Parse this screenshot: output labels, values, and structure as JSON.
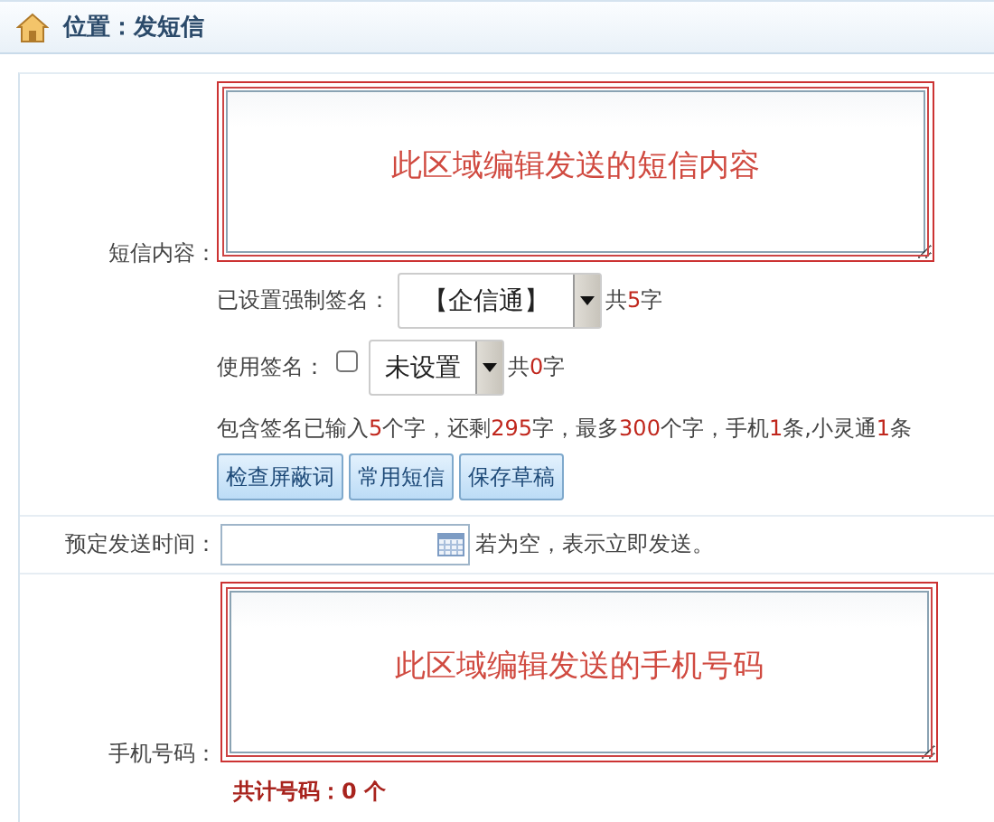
{
  "breadcrumb": {
    "label": "位置：发短信"
  },
  "message": {
    "label": "短信内容：",
    "placeholder": "此区域编辑发送的短信内容"
  },
  "forced_signature": {
    "label": "已设置强制签名：",
    "value": "【企信通】",
    "count": [
      {
        "text": "共",
        "highlight": false
      },
      {
        "text": "5",
        "highlight": true
      },
      {
        "text": "字",
        "highlight": false
      }
    ]
  },
  "use_signature": {
    "label": "使用签名：",
    "checked": false,
    "value": "未设置",
    "count": [
      {
        "text": "共",
        "highlight": false
      },
      {
        "text": "0",
        "highlight": true
      },
      {
        "text": "字",
        "highlight": false
      }
    ]
  },
  "summary": [
    {
      "text": "包含签名已输入",
      "highlight": false
    },
    {
      "text": "5",
      "highlight": true
    },
    {
      "text": "个字，还剩",
      "highlight": false
    },
    {
      "text": "295",
      "highlight": true
    },
    {
      "text": "字，最多",
      "highlight": false
    },
    {
      "text": "300",
      "highlight": true
    },
    {
      "text": "个字，手机",
      "highlight": false
    },
    {
      "text": "1",
      "highlight": true
    },
    {
      "text": "条,小灵通",
      "highlight": false
    },
    {
      "text": "1",
      "highlight": true
    },
    {
      "text": "条",
      "highlight": false
    }
  ],
  "buttons": [
    "检查屏蔽词",
    "常用短信",
    "保存草稿"
  ],
  "schedule": {
    "label": "预定发送时间：",
    "hint": "若为空，表示立即发送。"
  },
  "recipients": {
    "label": "手机号码：",
    "placeholder": "此区域编辑发送的手机号码",
    "total": "共计号码：0 个"
  }
}
